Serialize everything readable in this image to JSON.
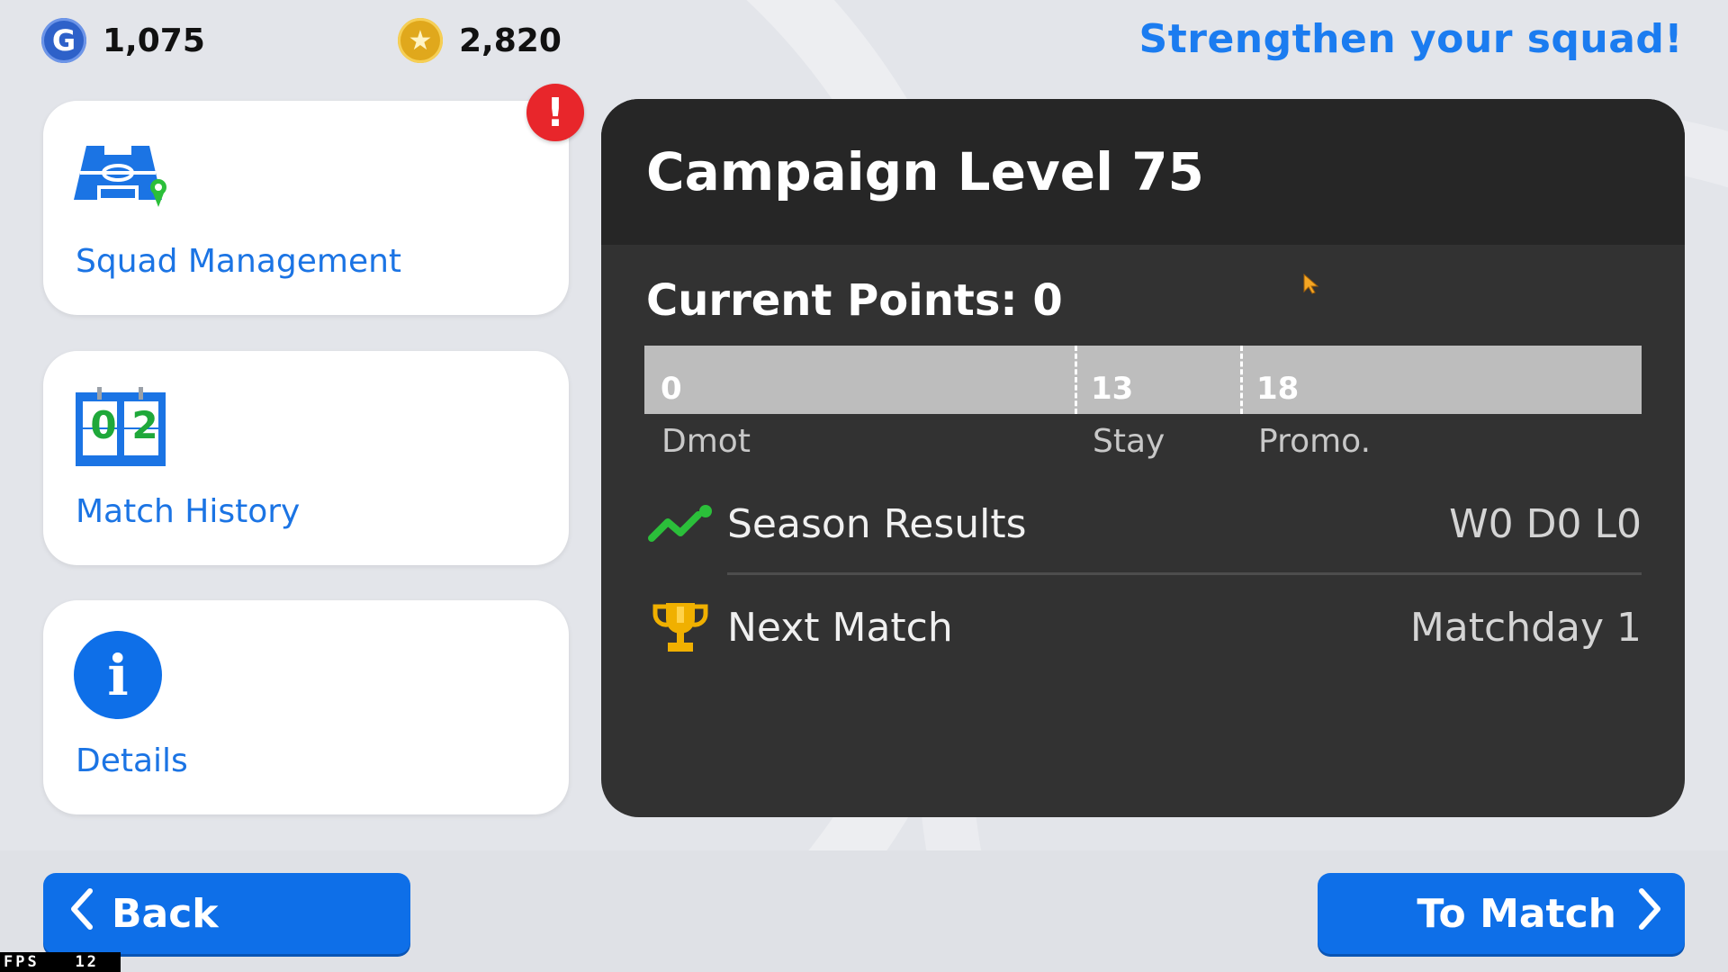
{
  "currencies": {
    "gp": {
      "icon": "gp-icon",
      "symbol": "G",
      "value": "1,075"
    },
    "coins": {
      "icon": "coin-star-icon",
      "symbol": "★",
      "value": "2,820"
    }
  },
  "headline": "Strengthen your squad!",
  "menu": {
    "squad": {
      "label": "Squad Management",
      "icon": "formation-pitch-icon",
      "alert": "!"
    },
    "history": {
      "label": "Match History",
      "icon": "scoreboard-icon",
      "digits": [
        "0",
        "2"
      ]
    },
    "details": {
      "label": "Details",
      "icon": "info-icon",
      "glyph": "i"
    }
  },
  "campaign": {
    "title": "Campaign Level 75",
    "current_points": "Current Points: 0",
    "points_value": 0,
    "thresholds": [
      {
        "value": "0",
        "label": "Dmot"
      },
      {
        "value": "13",
        "label": "Stay"
      },
      {
        "value": "18",
        "label": "Promo."
      }
    ],
    "season_results": {
      "label": "Season Results",
      "value": "W0 D0 L0",
      "icon": "trend-chart-icon"
    },
    "next_match": {
      "label": "Next Match",
      "value": "Matchday 1",
      "icon": "trophy-icon"
    }
  },
  "buttons": {
    "back": "Back",
    "to_match": "To Match"
  },
  "fps": {
    "label": "FPS",
    "value": "12"
  },
  "colors": {
    "accent_blue": "#1b7cf0",
    "button_blue": "#0e6fe8",
    "panel_dark": "#323232",
    "alert_red": "#e8262b",
    "trend_green": "#2bbf3a",
    "trophy_gold": "#f0b000"
  }
}
